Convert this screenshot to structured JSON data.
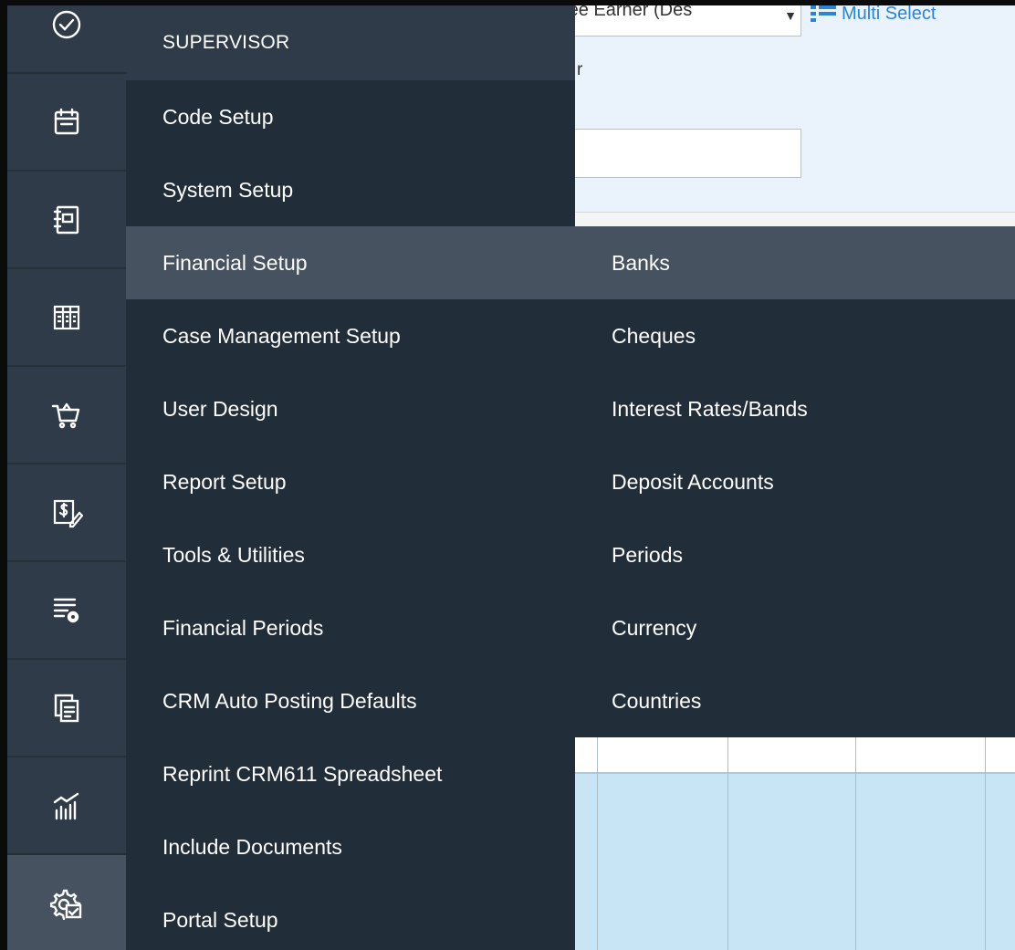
{
  "background_form": {
    "select_value": "Second Fee Earner (Des",
    "multi_select_label": "Multi Select",
    "field_label_fragment": "r",
    "text_input_value": ""
  },
  "rail": {
    "icons": [
      "dashboard-gauge-icon",
      "calendar-icon",
      "notebook-icon",
      "ledger-icon",
      "basket-icon",
      "invoice-pen-icon",
      "list-settings-icon",
      "copy-document-icon",
      "analytics-chart-icon",
      "supervisor-settings-icon"
    ],
    "active_index": 9
  },
  "menu": {
    "header": "SUPERVISOR",
    "items": [
      {
        "label": "Code Setup"
      },
      {
        "label": "System Setup"
      },
      {
        "label": "Financial Setup",
        "selected": true
      },
      {
        "label": "Case Management Setup"
      },
      {
        "label": "User Design"
      },
      {
        "label": "Report Setup"
      },
      {
        "label": "Tools & Utilities"
      },
      {
        "label": "Financial Periods"
      },
      {
        "label": "CRM Auto Posting Defaults"
      },
      {
        "label": "Reprint CRM611 Spreadsheet"
      },
      {
        "label": "Include Documents"
      },
      {
        "label": "Portal Setup"
      }
    ]
  },
  "submenu": {
    "items": [
      {
        "label": "Banks",
        "selected": true
      },
      {
        "label": "Cheques"
      },
      {
        "label": "Interest Rates/Bands"
      },
      {
        "label": "Deposit Accounts"
      },
      {
        "label": "Periods"
      },
      {
        "label": "Currency"
      },
      {
        "label": "Countries"
      }
    ]
  },
  "colors": {
    "rail_bg": "#2f3b48",
    "menu_bg": "#222d3a",
    "selected_bg": "#46525f",
    "link_blue": "#2b84d6",
    "grid_blue": "#c7e5f4"
  }
}
